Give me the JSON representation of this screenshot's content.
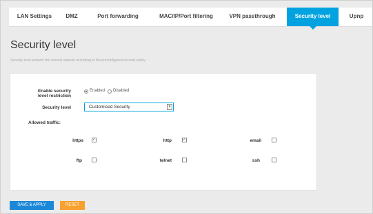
{
  "tabs": [
    {
      "label": "LAN Settings",
      "active": false
    },
    {
      "label": "DMZ",
      "active": false
    },
    {
      "label": "Port forwarding",
      "active": false
    },
    {
      "label": "MAC/IP/Port filtering",
      "active": false
    },
    {
      "label": "VPN passthrough",
      "active": false
    },
    {
      "label": "Security level",
      "active": true
    },
    {
      "label": "Upnp",
      "active": false
    }
  ],
  "page": {
    "title": "Security level",
    "description": "Security level protects the internal network according to the preconfigured security policy."
  },
  "form": {
    "restriction_label": "Enable security level restriction",
    "restriction_label_line1": "Enable security",
    "restriction_label_line2": "level restriction",
    "enabled_label": "Enabled",
    "disabled_label": "Disabled",
    "restriction_value": "Enabled",
    "security_level_label": "Security level",
    "security_level_value": "Customised Security",
    "allowed_traffic_label": "Allowed traffic:",
    "traffic": [
      {
        "label": "https",
        "checked": true
      },
      {
        "label": "http",
        "checked": true
      },
      {
        "label": "email",
        "checked": false
      },
      {
        "label": "ftp",
        "checked": false
      },
      {
        "label": "telnet",
        "checked": false
      },
      {
        "label": "ssh",
        "checked": false
      }
    ]
  },
  "buttons": {
    "save_label": "SAVE & APPLY",
    "reset_label": "RESET"
  },
  "colors": {
    "accent": "#00a3e0",
    "save": "#1e88d8",
    "reset": "#f7a12e"
  },
  "icons": {
    "select_arrow": "chevron-down-icon",
    "checked": "check-icon"
  }
}
